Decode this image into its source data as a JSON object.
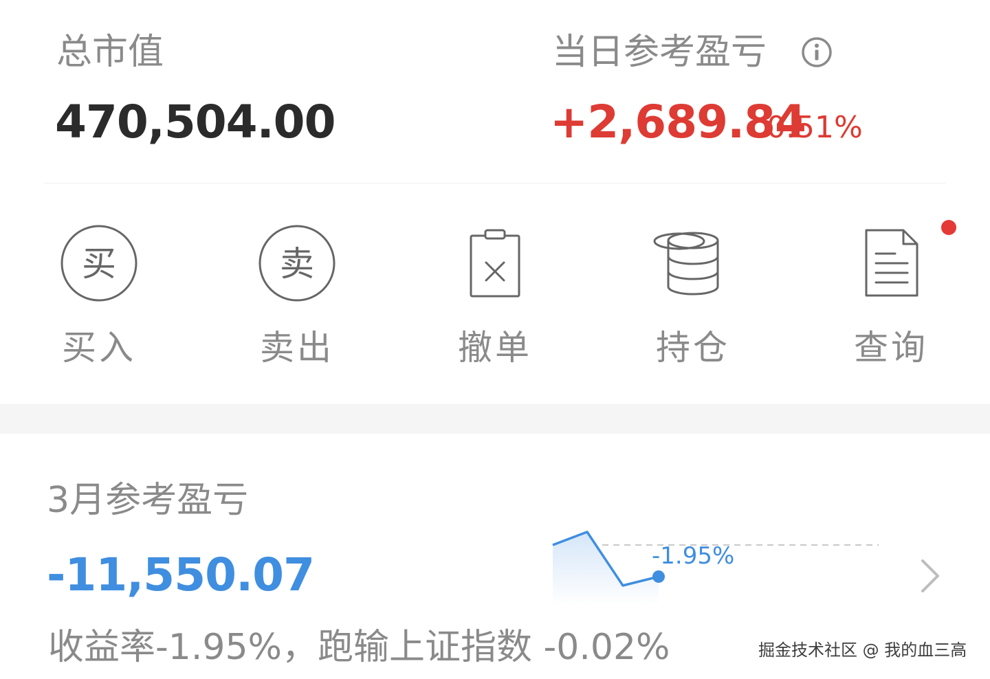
{
  "summary": {
    "total_market_value_label": "总市值",
    "total_market_value": "470,504.00",
    "daily_pnl_label": "当日参考盈亏",
    "daily_pnl_value": "+2,689.84",
    "daily_pnl_percent": "0.51%",
    "info_icon": "info-circle-icon"
  },
  "actions": [
    {
      "label": "买入",
      "icon": "buy-circle-icon",
      "glyph": "买"
    },
    {
      "label": "卖出",
      "icon": "sell-circle-icon",
      "glyph": "卖"
    },
    {
      "label": "撤单",
      "icon": "cancel-order-clipboard-icon"
    },
    {
      "label": "持仓",
      "icon": "database-stack-icon"
    },
    {
      "label": "查询",
      "icon": "document-icon",
      "badge": "red-dot"
    }
  ],
  "monthly": {
    "title": "3月参考盈亏",
    "value": "-11,550.07",
    "chart_end_label": "-1.95%",
    "summary": "收益率-1.95%，跑输上证指数 -0.02%",
    "chevron_icon": "chevron-right-icon"
  },
  "colors": {
    "gain_red": "#dd3b33",
    "loss_blue": "#3f8ee0",
    "label_gray": "#8a8a8a"
  },
  "watermark": "掘金技术社区 @ 我的血三高"
}
